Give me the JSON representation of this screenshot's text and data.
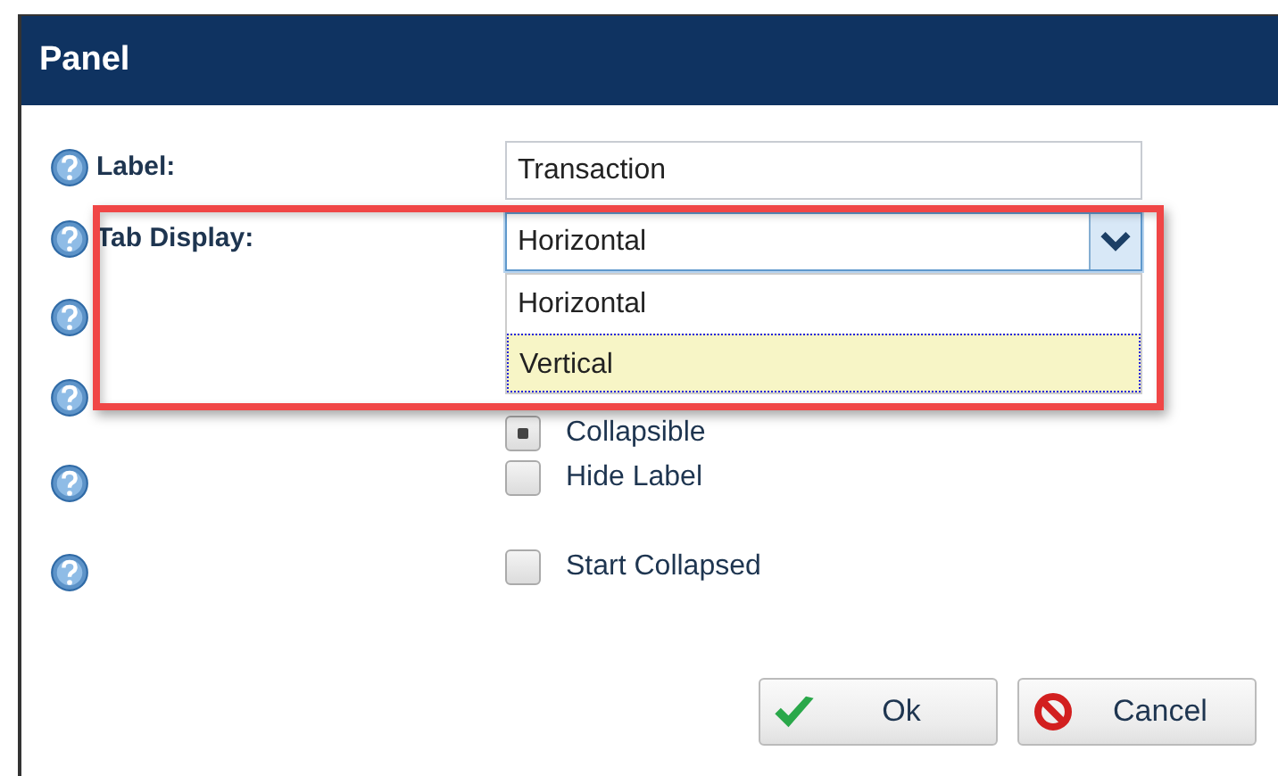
{
  "window": {
    "title": "Panel"
  },
  "fields": [
    {
      "kind": "text",
      "label": "Label:",
      "value": "Transaction"
    },
    {
      "kind": "select",
      "label": "Tab Display:",
      "value": "Horizontal",
      "expanded": true,
      "options": [
        {
          "label": "Horizontal",
          "highlighted": false
        },
        {
          "label": "Vertical",
          "highlighted": true
        }
      ]
    }
  ],
  "checkboxes": [
    {
      "label": "Collapsible",
      "checked": true
    },
    {
      "label": "Hide Label",
      "checked": false
    },
    {
      "label": "Start Collapsed",
      "checked": false
    }
  ],
  "buttons": [
    {
      "kind": "ok",
      "label": "Ok"
    },
    {
      "kind": "cancel",
      "label": "Cancel"
    }
  ]
}
